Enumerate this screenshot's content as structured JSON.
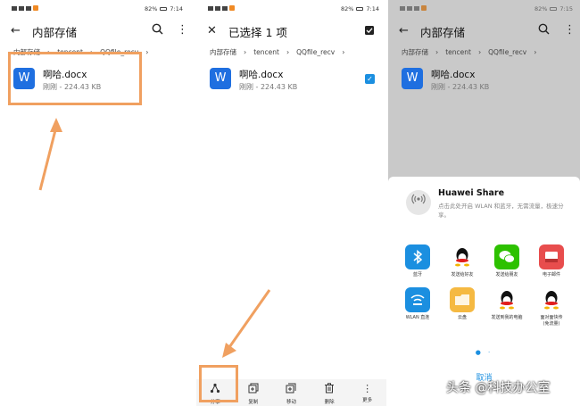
{
  "status": {
    "percent": "82%",
    "time": "7:14",
    "time_s3": "7:15"
  },
  "panel1": {
    "back_icon": "back-arrow-icon",
    "title": "内部存储",
    "breadcrumb": [
      "内部存储",
      "tencent",
      "QQfile_recv"
    ],
    "file": {
      "name": "啊哈.docx",
      "meta": "刚刚 - 224.43 KB",
      "icon_letter": "W"
    }
  },
  "panel2": {
    "title": "已选择 1 项",
    "breadcrumb": [
      "内部存储",
      "tencent",
      "QQfile_recv"
    ],
    "file": {
      "name": "啊哈.docx",
      "meta": "刚刚 - 224.43 KB",
      "icon_letter": "W"
    },
    "bottom_bar": [
      {
        "icon": "share-icon",
        "label": "分享"
      },
      {
        "icon": "copy-icon",
        "label": "复制"
      },
      {
        "icon": "move-icon",
        "label": "移动"
      },
      {
        "icon": "delete-icon",
        "label": "删除"
      },
      {
        "icon": "more-icon",
        "label": "更多"
      }
    ]
  },
  "panel3": {
    "title": "内部存储",
    "breadcrumb": [
      "内部存储",
      "tencent",
      "QQfile_recv"
    ],
    "file": {
      "name": "啊哈.docx",
      "meta": "刚刚 - 224.43 KB",
      "icon_letter": "W"
    },
    "share_sheet": {
      "huawei_share_title": "Huawei Share",
      "huawei_share_desc": "点击此处开启 WLAN 和蓝牙，无需流量，极速分享。",
      "apps": [
        {
          "label": "蓝牙",
          "icon": "bluetooth-icon",
          "color": "#1b8fe0"
        },
        {
          "label": "发送给好友",
          "icon": "qq-icon",
          "color": "#ffffff"
        },
        {
          "label": "发送给朋友",
          "icon": "wechat-icon",
          "color": "#2dc100"
        },
        {
          "label": "电子邮件",
          "icon": "email-icon",
          "color": "#e84d4d"
        },
        {
          "label": "WLAN 直连",
          "icon": "wlan-direct-icon",
          "color": "#1b8fe0"
        },
        {
          "label": "云盘",
          "icon": "cloud-drive-icon",
          "color": "#f5b942"
        },
        {
          "label": "发送到我的电脑",
          "icon": "qq-icon",
          "color": "#ffffff"
        },
        {
          "label": "面对面快传\n(免流量)",
          "icon": "qq-icon",
          "color": "#ffffff"
        }
      ],
      "cancel_label": "取消"
    }
  },
  "watermark": "头条 @科技办公室",
  "colors": {
    "accent": "#1b8fe0",
    "highlight": "#f0a060",
    "word_blue": "#1f6fe0"
  }
}
